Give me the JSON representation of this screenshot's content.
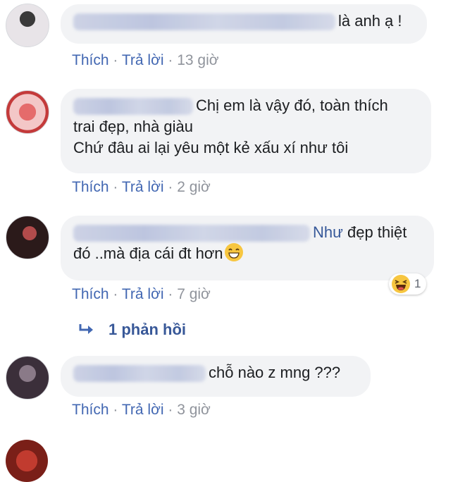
{
  "comments": [
    {
      "text_lines": [
        "là anh ạ !"
      ],
      "actions": {
        "like": "Thích",
        "reply": "Trả lời",
        "sep": "·",
        "time": "13 giờ"
      }
    },
    {
      "text_lines": [
        "Chị em là vậy đó, toàn thích",
        "trai đẹp, nhà giàu",
        "Chứ đâu ai lại yêu một kẻ xấu xí như tôi"
      ],
      "actions": {
        "like": "Thích",
        "reply": "Trả lời",
        "sep": "·",
        "time": "2 giờ"
      }
    },
    {
      "name_fragment": "Như",
      "text_lines": [
        "đẹp thiệt",
        "đó ..mà địa cái đt hơn"
      ],
      "actions": {
        "like": "Thích",
        "reply": "Trả lời",
        "sep": "·",
        "time": "7 giờ"
      },
      "reaction": {
        "icon": "haha-emoji",
        "count": "1"
      },
      "replies_link": "1 phản hồi"
    },
    {
      "text_lines": [
        "chỗ nào z mng ???"
      ],
      "actions": {
        "like": "Thích",
        "reply": "Trả lời",
        "sep": "·",
        "time": "3 giờ"
      }
    }
  ]
}
